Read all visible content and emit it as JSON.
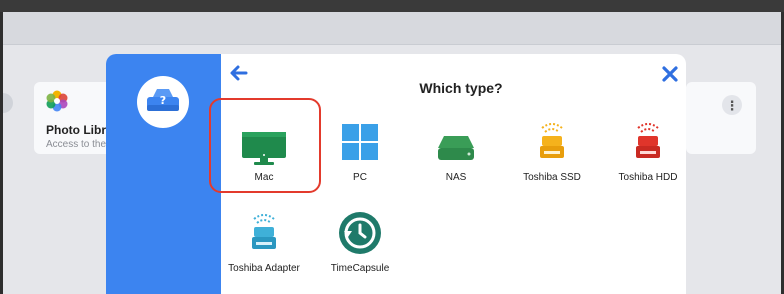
{
  "background_cards": {
    "left": {
      "title": "Photo Libra",
      "subtitle": "Access to the",
      "icon": "photos-app-icon"
    },
    "right": {
      "menu_label": "⋮"
    }
  },
  "modal": {
    "title": "Which type?",
    "back_icon": "arrow-left-icon",
    "close_icon": "close-icon",
    "brand_icon": "drive-help-icon",
    "accent_color": "#3c84f0",
    "selected_type": "Mac",
    "types": [
      {
        "label": "Mac",
        "icon": "monitor-icon"
      },
      {
        "label": "PC",
        "icon": "windows-logo-icon"
      },
      {
        "label": "NAS",
        "icon": "nas-drive-icon"
      },
      {
        "label": "Toshiba SSD",
        "icon": "toshiba-ssd-icon"
      },
      {
        "label": "Toshiba HDD",
        "icon": "toshiba-hdd-icon"
      },
      {
        "label": "Toshiba Adapter",
        "icon": "toshiba-adapter-icon"
      },
      {
        "label": "TimeCapsule",
        "icon": "time-capsule-icon"
      }
    ]
  },
  "colors": {
    "selection_ring": "#e33a2c",
    "mac_green": "#1f8a4c",
    "pc_blue": "#3aa0e8",
    "ssd_yellow": "#f5b21c",
    "hdd_red": "#e0352b",
    "adapter_teal": "#3fb0d8"
  }
}
